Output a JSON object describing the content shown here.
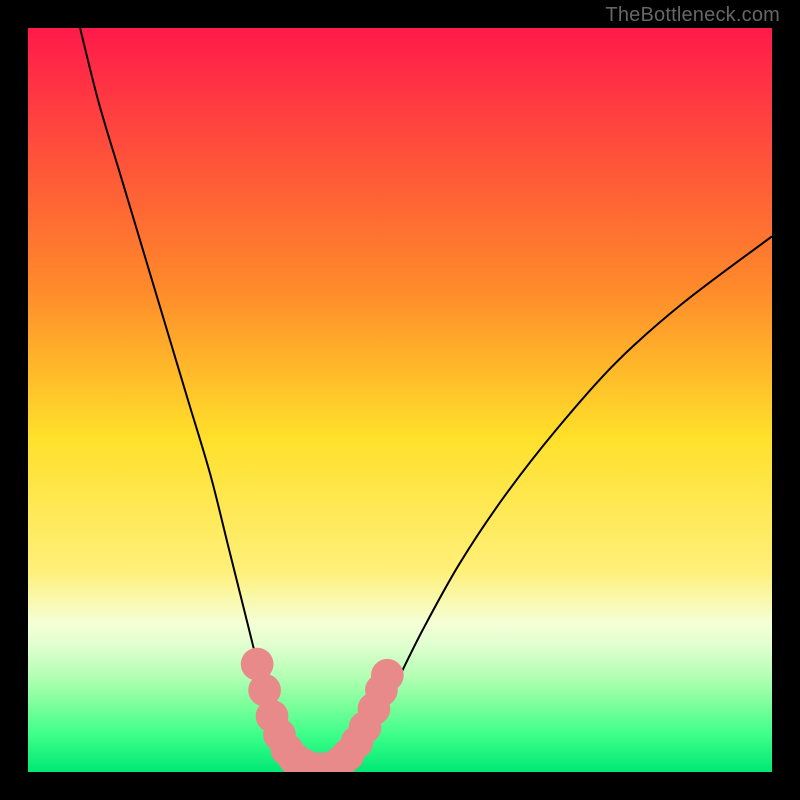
{
  "watermark": "TheBottleneck.com",
  "chart_data": {
    "type": "line",
    "title": "",
    "xlabel": "",
    "ylabel": "",
    "xlim": [
      0,
      100
    ],
    "ylim": [
      0,
      100
    ],
    "background_gradient": {
      "stops": [
        {
          "offset": 0,
          "color": "#ff1a4a"
        },
        {
          "offset": 35,
          "color": "#ff8a2a"
        },
        {
          "offset": 55,
          "color": "#ffe02a"
        },
        {
          "offset": 73,
          "color": "#fff07a"
        },
        {
          "offset": 80,
          "color": "#f5ffd6"
        },
        {
          "offset": 83,
          "color": "#e0ffd0"
        },
        {
          "offset": 87,
          "color": "#b5ffb5"
        },
        {
          "offset": 91,
          "color": "#7cff9a"
        },
        {
          "offset": 95,
          "color": "#3dff8a"
        },
        {
          "offset": 100,
          "color": "#00e874"
        }
      ]
    },
    "series": [
      {
        "name": "bottleneck-curve",
        "color": "#000000",
        "width": 2.0,
        "points": [
          {
            "x": 7.0,
            "y": 100.0
          },
          {
            "x": 9.5,
            "y": 90.0
          },
          {
            "x": 12.5,
            "y": 80.0
          },
          {
            "x": 15.5,
            "y": 70.0
          },
          {
            "x": 18.5,
            "y": 60.0
          },
          {
            "x": 21.5,
            "y": 50.0
          },
          {
            "x": 24.5,
            "y": 40.0
          },
          {
            "x": 27.0,
            "y": 30.0
          },
          {
            "x": 29.5,
            "y": 20.0
          },
          {
            "x": 31.5,
            "y": 12.0
          },
          {
            "x": 33.0,
            "y": 7.0
          },
          {
            "x": 34.5,
            "y": 3.5
          },
          {
            "x": 36.0,
            "y": 1.5
          },
          {
            "x": 38.0,
            "y": 0.5
          },
          {
            "x": 40.0,
            "y": 0.3
          },
          {
            "x": 42.0,
            "y": 0.8
          },
          {
            "x": 44.0,
            "y": 2.5
          },
          {
            "x": 46.0,
            "y": 5.5
          },
          {
            "x": 49.0,
            "y": 11.0
          },
          {
            "x": 53.0,
            "y": 19.0
          },
          {
            "x": 58.0,
            "y": 28.0
          },
          {
            "x": 64.0,
            "y": 37.0
          },
          {
            "x": 71.0,
            "y": 46.0
          },
          {
            "x": 79.0,
            "y": 55.0
          },
          {
            "x": 88.0,
            "y": 63.0
          },
          {
            "x": 100.0,
            "y": 72.0
          }
        ]
      }
    ],
    "markers": {
      "color": "#e88a8a",
      "radius": 2.2,
      "points": [
        {
          "x": 30.8,
          "y": 14.5
        },
        {
          "x": 31.8,
          "y": 11.0
        },
        {
          "x": 32.8,
          "y": 7.5
        },
        {
          "x": 33.8,
          "y": 5.0
        },
        {
          "x": 34.8,
          "y": 3.0
        },
        {
          "x": 35.8,
          "y": 1.8
        },
        {
          "x": 37.0,
          "y": 1.0
        },
        {
          "x": 38.2,
          "y": 0.5
        },
        {
          "x": 39.5,
          "y": 0.4
        },
        {
          "x": 40.8,
          "y": 0.6
        },
        {
          "x": 42.0,
          "y": 1.3
        },
        {
          "x": 43.0,
          "y": 2.3
        },
        {
          "x": 44.2,
          "y": 4.0
        },
        {
          "x": 45.3,
          "y": 6.0
        },
        {
          "x": 46.5,
          "y": 8.5
        },
        {
          "x": 47.5,
          "y": 11.0
        },
        {
          "x": 48.3,
          "y": 13.0
        }
      ]
    }
  }
}
